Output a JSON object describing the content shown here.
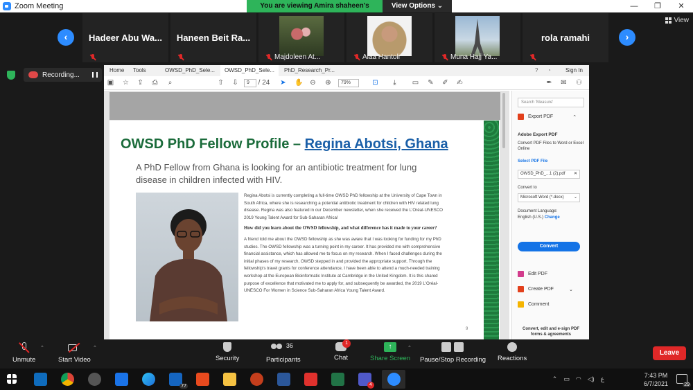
{
  "window": {
    "title": "Zoom Meeting",
    "controls": [
      "—",
      "❐",
      "✕"
    ]
  },
  "banner": {
    "viewing": "You are viewing Amira shaheen's screen",
    "view_options": "View Options ⌄"
  },
  "gallery": {
    "view_label": "View",
    "participants": [
      {
        "name": "Hadeer  Abu  Wa...",
        "label": ""
      },
      {
        "name": "Haneen  Beit  Ra...",
        "label": ""
      },
      {
        "name": "",
        "label": "Majdoleen At..."
      },
      {
        "name": "",
        "label": "Alaa Hantoli"
      },
      {
        "name": "",
        "label": "Muna Hajj Ya..."
      },
      {
        "name": "rola  ramahi",
        "label": ""
      }
    ]
  },
  "recording": {
    "label": "Recording..."
  },
  "browser": {
    "tabs": [
      "Home",
      "Tools",
      "OWSD_PhD_Sele...",
      "OWSD_PhD_Sele...",
      "PhD_Research_Pr..."
    ],
    "sign_in": "Sign In",
    "page_current": "9",
    "page_total": "/  24",
    "zoom": "79%"
  },
  "document": {
    "title_prefix": "OWSD PhD Fellow Profile – ",
    "title_link": "Regina Abotsi, Ghana",
    "subtitle": "A PhD Fellow from Ghana is looking for an antibiotic treatment for lung disease in children infected with HIV.",
    "para1": "Regina Abotsi is currently completing a full-time OWSD PhD fellowship at the University of Cape Town in South Africa, where she is researching a potential antibiotic treatment for children with HIV related lung disease. Regina was also featured in our December newsletter, when she received the L'Oréal-UNESCO 2019 Young Talent Award for Sub-Saharan Africa!",
    "question": "How did you learn about the OWSD fellowship, and what difference has it made to your career?",
    "para2": "A friend told me about the OWSD fellowship as she was aware that I was looking for funding for my PhD studies. The OWSD fellowship was a turning point in my career. It has provided me with comprehensive financial assistance, which has allowed me to focus on my research. When I faced challenges during the initial phases of my research, OWSD stepped in and provided the appropriate support. Through the fellowship's travel grants for conference attendance, I have been able to attend a much-needed training workshop at the European Bioinformatic Institute at Cambridge in the United Kingdom. It is this shared purpose of excellence that motivated me to apply for, and subsequently be awarded, the 2019 L'Oréal-UNESCO For Women in Science Sub-Saharan Africa Young Talent Award.",
    "page_number": "9"
  },
  "right_pane": {
    "search_placeholder": "Search 'Measure'",
    "export_pdf": "Export PDF",
    "adobe_export": "Adobe Export PDF",
    "convert_desc": "Convert PDF Files to Word or Excel Online",
    "select_pdf": "Select PDF File",
    "file_name": "OWSD_PhD_...1 (2).pdf",
    "convert_to": "Convert to",
    "format": "Microsoft Word (*.docx)",
    "doc_language": "Document Language:",
    "language": "English (U.S.)",
    "change": "Change",
    "convert_btn": "Convert",
    "edit_pdf": "Edit PDF",
    "create_pdf": "Create PDF",
    "comment": "Comment",
    "footer": "Convert, edit and e-sign PDF forms & agreements"
  },
  "controls": {
    "unmute": "Unmute",
    "start_video": "Start Video",
    "security": "Security",
    "participants": "Participants",
    "participants_count": "36",
    "chat": "Chat",
    "chat_badge": "1",
    "share_screen": "Share Screen",
    "pause_recording": "Pause/Stop Recording",
    "reactions": "Reactions",
    "leave": "Leave"
  },
  "taskbar": {
    "time": "7:43 PM",
    "date": "6/7/2021",
    "mail_badge": "77",
    "teams_badge": "4",
    "notifications": "29",
    "lang": "ع"
  },
  "colors": {
    "zoom_blue": "#2D8CFF",
    "owsd_green": "#1a6b3a",
    "leave_red": "#e02828",
    "banner_green": "#2EB45A"
  }
}
